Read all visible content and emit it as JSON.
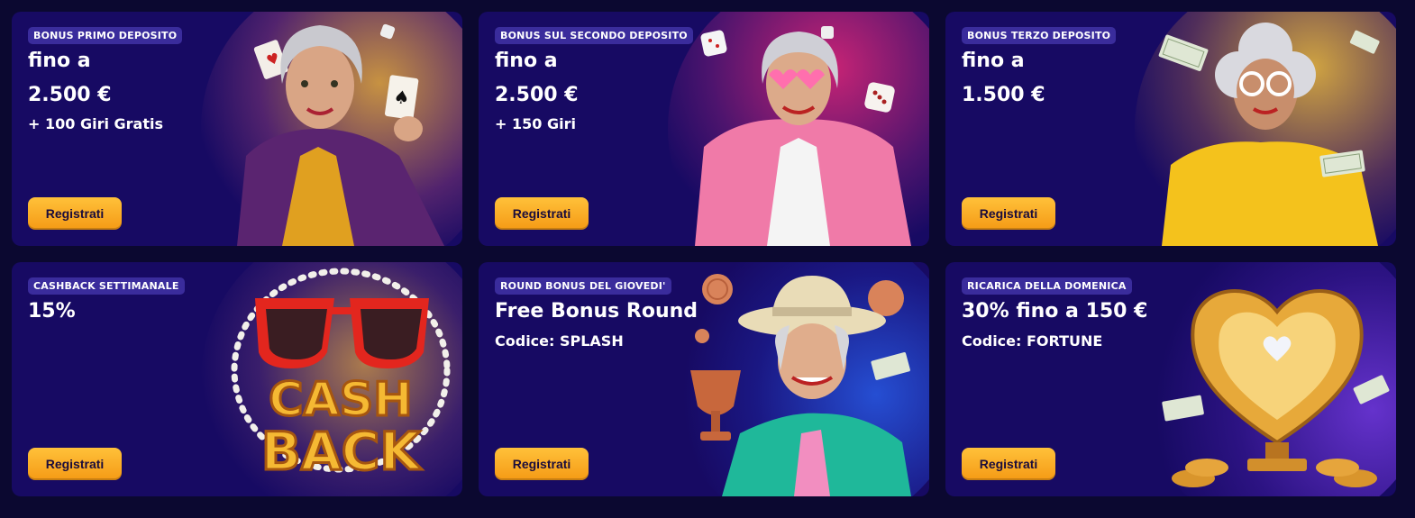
{
  "cards": [
    {
      "badge": "BONUS PRIMO DEPOSITO",
      "headline": "fino a",
      "amount": "2.500 €",
      "sub": "+ 100 Giri Gratis",
      "cta": "Registrati"
    },
    {
      "badge": "BONUS SUL SECONDO DEPOSITO",
      "headline": "fino a",
      "amount": "2.500 €",
      "sub": "+ 150 Giri",
      "cta": "Registrati"
    },
    {
      "badge": "BONUS TERZO DEPOSITO",
      "headline": "fino a",
      "amount": "1.500 €",
      "cta": "Registrati"
    },
    {
      "badge": "CASHBACK SETTIMANALE",
      "headline": "15%",
      "art_text_1": "CASH",
      "art_text_2": "BACK",
      "cta": "Registrati"
    },
    {
      "badge": "ROUND BONUS DEL GIOVEDI'",
      "headline": "Free Bonus Round",
      "line2": "Codice: SPLASH",
      "cta": "Registrati"
    },
    {
      "badge": "RICARICA DELLA DOMENICA",
      "headline": "30% fino a 150 €",
      "line2": "Codice: FORTUNE",
      "cta": "Registrati"
    }
  ],
  "colors": {
    "page_bg": "#0b0830",
    "card_bg": "#170a63",
    "badge_bg": "#3a2c9c",
    "button_gradient_top": "#ffc13a",
    "button_gradient_bottom": "#f59a15"
  }
}
